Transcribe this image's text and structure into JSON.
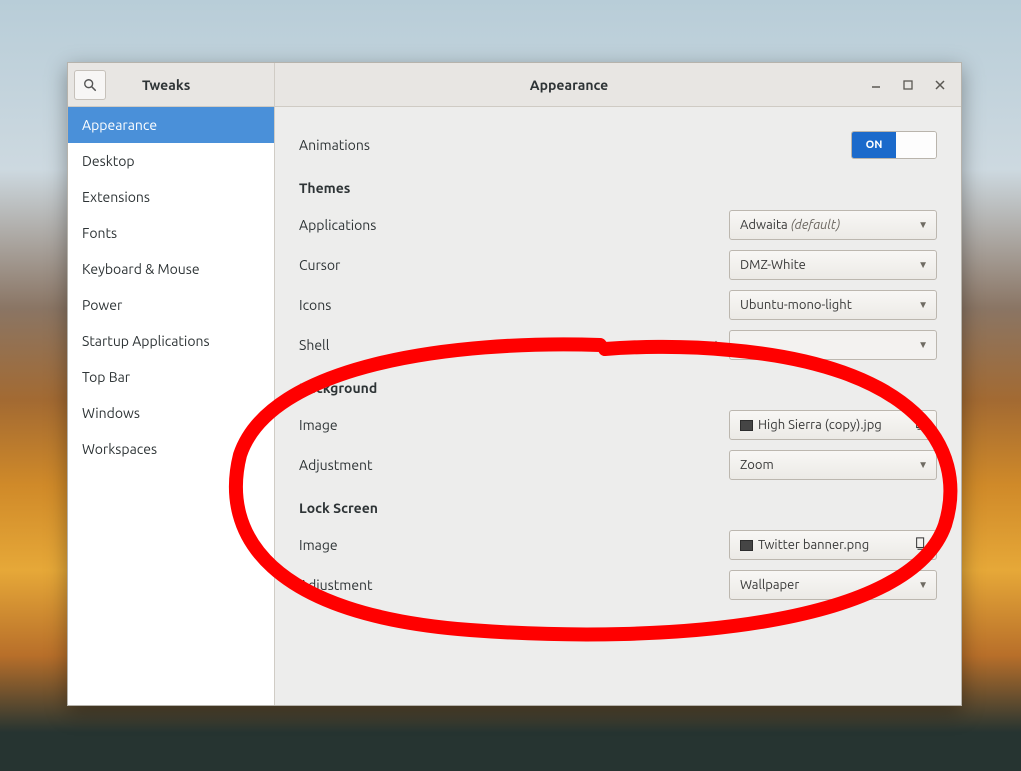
{
  "app": {
    "title": "Tweaks",
    "page_title": "Appearance"
  },
  "sidebar": {
    "items": [
      {
        "label": "Appearance",
        "selected": true
      },
      {
        "label": "Desktop"
      },
      {
        "label": "Extensions"
      },
      {
        "label": "Fonts"
      },
      {
        "label": "Keyboard & Mouse"
      },
      {
        "label": "Power"
      },
      {
        "label": "Startup Applications"
      },
      {
        "label": "Top Bar"
      },
      {
        "label": "Windows"
      },
      {
        "label": "Workspaces"
      }
    ]
  },
  "content": {
    "animations": {
      "label": "Animations",
      "state": "ON"
    },
    "themes": {
      "heading": "Themes",
      "applications": {
        "label": "Applications",
        "value": "Adwaita",
        "suffix": "(default)"
      },
      "cursor": {
        "label": "Cursor",
        "value": "DMZ-White"
      },
      "icons": {
        "label": "Icons",
        "value": "Ubuntu-mono-light"
      },
      "shell": {
        "label": "Shell",
        "value": "",
        "disabled": true
      }
    },
    "background": {
      "heading": "Background",
      "image": {
        "label": "Image",
        "value": "High Sierra (copy).jpg"
      },
      "adjustment": {
        "label": "Adjustment",
        "value": "Zoom"
      }
    },
    "lockscreen": {
      "heading": "Lock Screen",
      "image": {
        "label": "Image",
        "value": "Twitter banner.png"
      },
      "adjustment": {
        "label": "Adjustment",
        "value": "Wallpaper"
      }
    }
  }
}
